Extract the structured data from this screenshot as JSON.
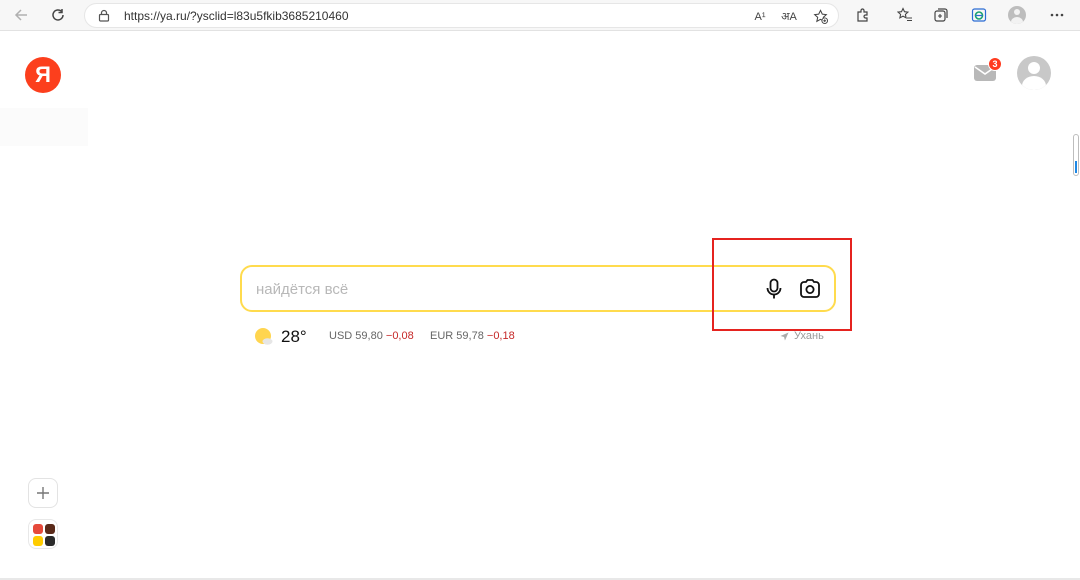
{
  "browser": {
    "url": "https://ya.ru/?ysclid=l83u5fkib3685210460",
    "read_aloud_label": "A¹",
    "translate_label": "अA"
  },
  "header": {
    "logo_text": "Я",
    "mail_badge_count": "3"
  },
  "search": {
    "placeholder": "найдётся всё",
    "value": ""
  },
  "info": {
    "temperature": "28°",
    "usd": {
      "label": "USD",
      "value": "59,80",
      "change": "−0,08"
    },
    "eur": {
      "label": "EUR",
      "value": "59,78",
      "change": "−0,18"
    },
    "location": "Ухань"
  },
  "colors": {
    "brand": "#fc3f1d",
    "search_border": "#ffdb4d",
    "negative_change": "#c62828",
    "annotation_box": "#e5231f"
  },
  "icons": {
    "back": "arrow-left-icon",
    "reload": "reload-icon",
    "lock": "lock-icon",
    "read_aloud": "read-aloud-icon",
    "translate": "translate-icon",
    "favorite_add": "star-plus-icon",
    "extensions": "puzzle-icon",
    "favorites": "star-list-icon",
    "collections": "collections-icon",
    "edge": "edge-logo-icon",
    "profile": "profile-icon",
    "menu": "more-icon",
    "mail": "mail-icon",
    "microphone": "microphone-icon",
    "camera": "camera-search-icon",
    "weather": "sun-cloud-icon",
    "location": "location-arrow-icon",
    "add": "plus-icon",
    "apps": "apps-grid-icon"
  }
}
